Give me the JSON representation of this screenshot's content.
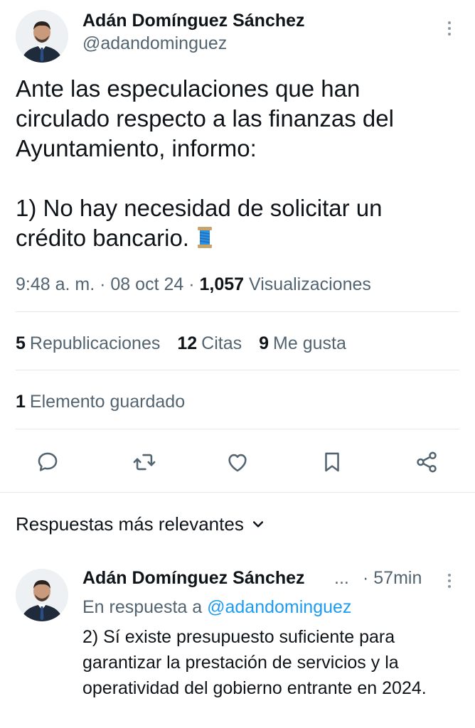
{
  "tweet": {
    "author_name": "Adán Domínguez Sánchez",
    "author_handle": "@adandominguez",
    "text": "Ante las especulaciones que han circulado respecto a las finanzas del Ayuntamiento, informo:\n\n1) No hay necesidad de solicitar un crédito bancario.",
    "emoji": "🧵",
    "time": "9:48 a. m.",
    "date": "08 oct 24",
    "views_count": "1,057",
    "views_label": "Visualizaciones",
    "separator": "·"
  },
  "stats": {
    "reposts_count": "5",
    "reposts_label": "Republicaciones",
    "quotes_count": "12",
    "quotes_label": "Citas",
    "likes_count": "9",
    "likes_label": "Me gusta",
    "bookmarks_count": "1",
    "bookmarks_label": "Elemento guardado"
  },
  "replies_sort": {
    "label": "Respuestas más relevantes"
  },
  "reply": {
    "author_name": "Adán Domínguez Sánchez",
    "ellipsis": "...",
    "time": "· 57min",
    "in_reply_prefix": "En respuesta a",
    "in_reply_handle": "@adandominguez",
    "text": "2) Sí existe presupuesto suficiente para garantizar la prestación de servicios y la operatividad del gobierno entrante en 2024."
  },
  "icons": {
    "reply": "speech-bubble-icon",
    "repost": "repost-icon",
    "like": "heart-icon",
    "bookmark": "bookmark-icon",
    "share": "share-icon",
    "more": "vertical-ellipsis-icon",
    "sort": "chevron-down-icon"
  },
  "colors": {
    "text_primary": "#0f1419",
    "text_secondary": "#536471",
    "link": "#1d9bf0",
    "divider": "#e4e8eb"
  }
}
